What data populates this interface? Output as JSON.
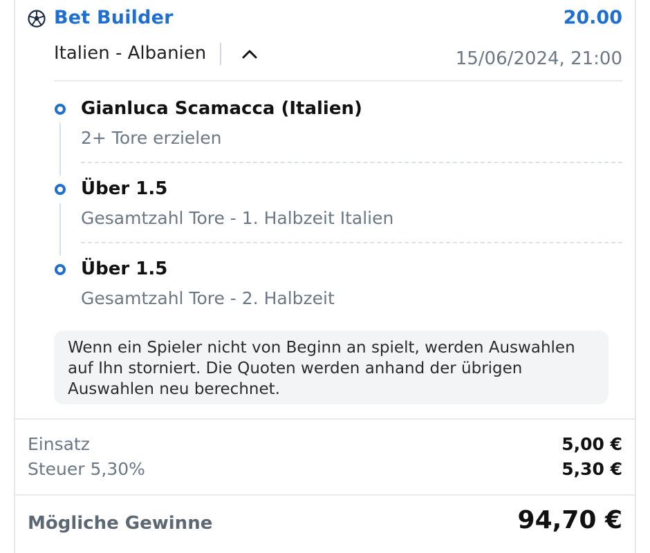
{
  "header": {
    "icon": "soccer-ball-icon",
    "title": "Bet Builder",
    "odds": "20.00",
    "accent_color": "#1f6fd1"
  },
  "match": {
    "name": "Italien - Albanien",
    "datetime": "15/06/2024, 21:00",
    "toggle_icon": "chevron-up-icon"
  },
  "selections": [
    {
      "name": "Gianluca Scamacca (Italien)",
      "market": "2+ Tore erzielen"
    },
    {
      "name": "Über 1.5",
      "market": "Gesamtzahl Tore - 1. Halbzeit Italien"
    },
    {
      "name": "Über 1.5",
      "market": "Gesamtzahl Tore - 2. Halbzeit"
    }
  ],
  "info": {
    "lines": [
      "Wenn ein Spieler nicht von Beginn an spielt, werden Auswahlen",
      "auf Ihn storniert. Die Quoten werden anhand der übrigen",
      "Auswahlen neu berechnet."
    ]
  },
  "summary": {
    "stake_label": "Einsatz",
    "stake_value": "5,00 €",
    "tax_label": "Steuer 5,30%",
    "tax_value": "5,30 €",
    "winnings_label": "Mögliche Gewinne",
    "winnings_value": "94,70 €"
  }
}
